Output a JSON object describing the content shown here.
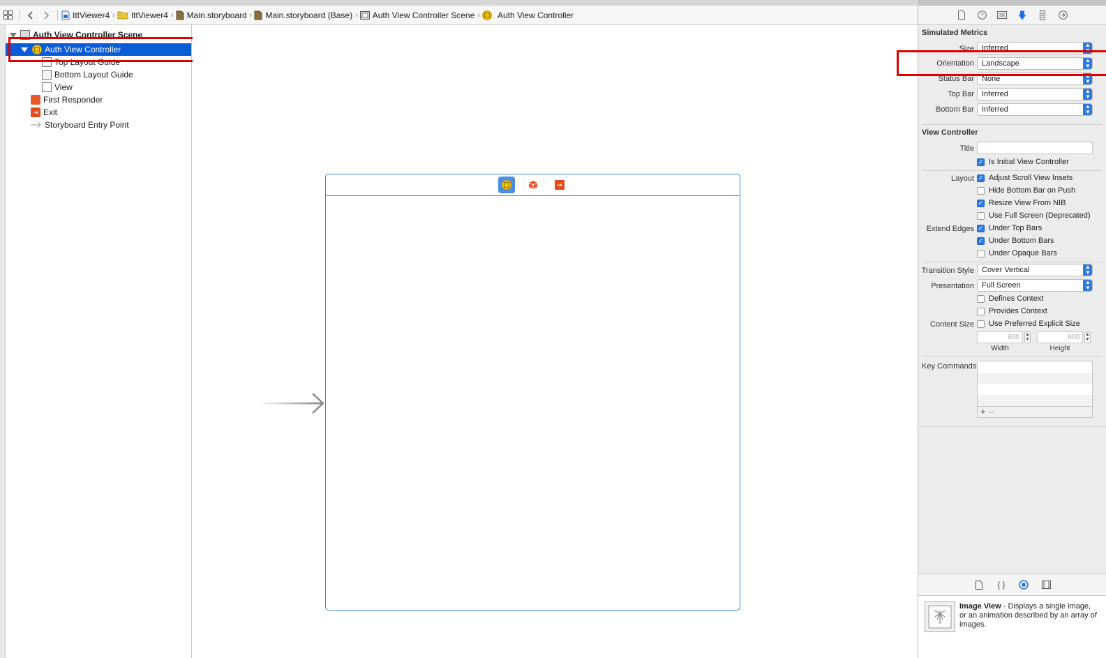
{
  "jumpbar": {
    "crumbs": [
      {
        "label": "IttViewer4",
        "icon": "project-file-icon"
      },
      {
        "label": "IttViewer4",
        "icon": "folder-icon"
      },
      {
        "label": "Main.storyboard",
        "icon": "storyboard-file-icon"
      },
      {
        "label": "Main.storyboard (Base)",
        "icon": "storyboard-file-icon"
      },
      {
        "label": "Auth View Controller Scene",
        "icon": "scene-icon"
      },
      {
        "label": "Auth View Controller",
        "icon": "view-controller-icon"
      }
    ]
  },
  "outline": {
    "scene": "Auth View Controller Scene",
    "controller": "Auth View Controller",
    "children": [
      "Top Layout Guide",
      "Bottom Layout Guide",
      "View"
    ],
    "first_responder": "First Responder",
    "exit": "Exit",
    "entry_point": "Storyboard Entry Point"
  },
  "inspector": {
    "simulated_metrics": {
      "title": "Simulated Metrics",
      "size_label": "Size",
      "size_value": "Inferred",
      "orientation_label": "Orientation",
      "orientation_value": "Landscape",
      "status_bar_label": "Status Bar",
      "status_bar_value": "None",
      "top_bar_label": "Top Bar",
      "top_bar_value": "Inferred",
      "bottom_bar_label": "Bottom Bar",
      "bottom_bar_value": "Inferred"
    },
    "view_controller": {
      "title": "View Controller",
      "title_label": "Title",
      "title_value": "",
      "is_initial": {
        "label": "Is Initial View Controller",
        "checked": true
      },
      "layout_label": "Layout",
      "layout_options": [
        {
          "label": "Adjust Scroll View Insets",
          "checked": true
        },
        {
          "label": "Hide Bottom Bar on Push",
          "checked": false
        },
        {
          "label": "Resize View From NIB",
          "checked": true
        },
        {
          "label": "Use Full Screen (Deprecated)",
          "checked": false
        }
      ],
      "extend_edges_label": "Extend Edges",
      "extend_edges": [
        {
          "label": "Under Top Bars",
          "checked": true
        },
        {
          "label": "Under Bottom Bars",
          "checked": true
        },
        {
          "label": "Under Opaque Bars",
          "checked": false
        }
      ],
      "transition_style_label": "Transition Style",
      "transition_style_value": "Cover Vertical",
      "presentation_label": "Presentation",
      "presentation_value": "Full Screen",
      "defines_context": {
        "label": "Defines Context",
        "checked": false
      },
      "provides_context": {
        "label": "Provides Context",
        "checked": false
      },
      "content_size_label": "Content Size",
      "use_preferred": {
        "label": "Use Preferred Explicit Size",
        "checked": false
      },
      "width_value": "600",
      "width_label": "Width",
      "height_value": "600",
      "height_label": "Height",
      "key_commands_label": "Key Commands",
      "key_commands_add": "+",
      "key_commands_remove": "—"
    }
  },
  "library": {
    "item_name": "Image View",
    "item_desc": " - Displays a single image, or an animation described by an array of images."
  },
  "colors": {
    "selection": "#0a5bd6",
    "accent": "#2e7be0",
    "annotation": "#e00000",
    "scene_border": "#3f86e8"
  }
}
